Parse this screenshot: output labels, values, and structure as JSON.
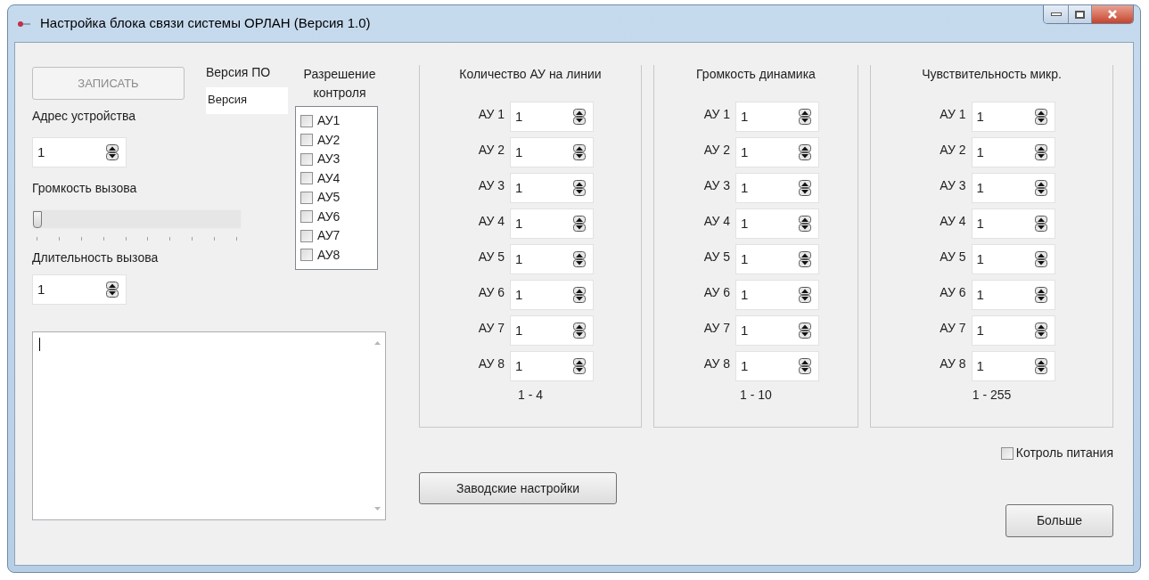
{
  "window": {
    "title": "Настройка блока связи системы ОРЛАН (Версия 1.0)"
  },
  "write_button": {
    "label": "ЗАПИСАТЬ",
    "disabled": true
  },
  "software_version": {
    "label": "Версия ПО",
    "value": "Версия"
  },
  "device_address": {
    "label": "Адрес устройства",
    "value": "1"
  },
  "call_volume": {
    "label": "Громкость вызова",
    "level": 0
  },
  "call_duration": {
    "label": "Длительность вызова",
    "value": "1"
  },
  "control_permission": {
    "label": "Разрешение контроля",
    "items": [
      {
        "label": "АУ1",
        "checked": false
      },
      {
        "label": "АУ2",
        "checked": false
      },
      {
        "label": "АУ3",
        "checked": false
      },
      {
        "label": "АУ4",
        "checked": false
      },
      {
        "label": "АУ5",
        "checked": false
      },
      {
        "label": "АУ6",
        "checked": false
      },
      {
        "label": "АУ7",
        "checked": false
      },
      {
        "label": "АУ8",
        "checked": false
      }
    ]
  },
  "groups": [
    {
      "title": "Количество АУ на линии",
      "range": "1 - 4",
      "rows": [
        {
          "label": "АУ 1",
          "value": "1"
        },
        {
          "label": "АУ 2",
          "value": "1"
        },
        {
          "label": "АУ 3",
          "value": "1"
        },
        {
          "label": "АУ 4",
          "value": "1"
        },
        {
          "label": "АУ 5",
          "value": "1"
        },
        {
          "label": "АУ 6",
          "value": "1"
        },
        {
          "label": "АУ 7",
          "value": "1"
        },
        {
          "label": "АУ 8",
          "value": "1"
        }
      ]
    },
    {
      "title": "Громкость динамика",
      "range": "1 - 10",
      "rows": [
        {
          "label": "АУ 1",
          "value": "1"
        },
        {
          "label": "АУ 2",
          "value": "1"
        },
        {
          "label": "АУ 3",
          "value": "1"
        },
        {
          "label": "АУ 4",
          "value": "1"
        },
        {
          "label": "АУ 5",
          "value": "1"
        },
        {
          "label": "АУ 6",
          "value": "1"
        },
        {
          "label": "АУ 7",
          "value": "1"
        },
        {
          "label": "АУ 8",
          "value": "1"
        }
      ]
    },
    {
      "title": "Чувствительность микр.",
      "range": "1 - 255",
      "rows": [
        {
          "label": "АУ 1",
          "value": "1"
        },
        {
          "label": "АУ 2",
          "value": "1"
        },
        {
          "label": "АУ 3",
          "value": "1"
        },
        {
          "label": "АУ 4",
          "value": "1"
        },
        {
          "label": "АУ 5",
          "value": "1"
        },
        {
          "label": "АУ 6",
          "value": "1"
        },
        {
          "label": "АУ 7",
          "value": "1"
        },
        {
          "label": "АУ 8",
          "value": "1"
        }
      ]
    }
  ],
  "factory_button": {
    "label": "Заводские настройки"
  },
  "power_control": {
    "label": "Котроль питания",
    "checked": false
  },
  "more_button": {
    "label": "Больше"
  }
}
